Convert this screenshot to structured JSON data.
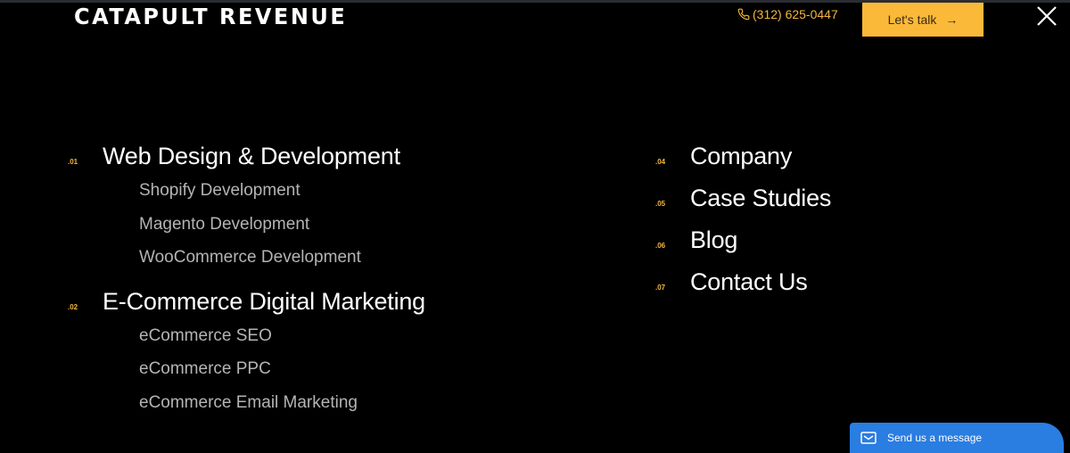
{
  "header": {
    "logo": "CATAPULT REVENUE",
    "phone": "(312) 625-0447",
    "cta_label": "Let's talk",
    "cta_arrow": "→",
    "close_icon": "close-icon"
  },
  "menu": {
    "left": [
      {
        "number": ".01",
        "label": "Web Design & Development",
        "children": [
          "Shopify Development",
          "Magento Development",
          "WooCommerce Development"
        ]
      },
      {
        "number": ".02",
        "label": "E-Commerce Digital Marketing",
        "children": [
          "eCommerce SEO",
          "eCommerce PPC",
          "eCommerce Email Marketing"
        ]
      }
    ],
    "right": [
      {
        "number": ".04",
        "label": "Company"
      },
      {
        "number": ".05",
        "label": "Case Studies"
      },
      {
        "number": ".06",
        "label": "Blog"
      },
      {
        "number": ".07",
        "label": "Contact Us"
      }
    ]
  },
  "chat": {
    "label": "Send us a message"
  },
  "colors": {
    "accent": "#fbb93a",
    "chat": "#2a7de1",
    "background": "#000000"
  }
}
